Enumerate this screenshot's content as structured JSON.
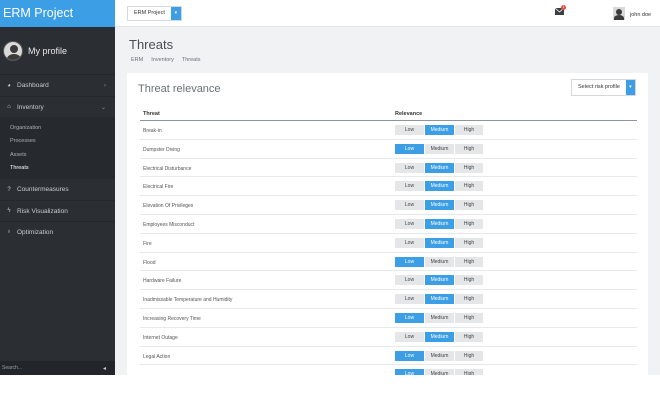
{
  "app": {
    "brand": "ERM Project"
  },
  "profile": {
    "label": "My profile"
  },
  "nav": {
    "dashboard": "Dashboard",
    "inventory": "Inventory",
    "inventory_children": [
      "Organization",
      "Processes",
      "Assets",
      "Threats"
    ],
    "countermeasures": "Countermeasures",
    "risk_visualization": "Risk Visualization",
    "optimization": "Optimization"
  },
  "sidebar_footer": {
    "search_placeholder": "Search..."
  },
  "topbar": {
    "project": "ERM Project",
    "mail_count": "1",
    "user": "john doe"
  },
  "page": {
    "title": "Threats",
    "breadcrumb": [
      "ERM",
      "Inventory",
      "Threats"
    ]
  },
  "panel": {
    "title": "Threat relevance",
    "risk_select_label": "Select risk profile",
    "columns": {
      "threat": "Threat",
      "relevance": "Relevance"
    },
    "levels": {
      "low": "Low",
      "medium": "Medium",
      "high": "High"
    },
    "rows": [
      {
        "name": "Break-in",
        "relevance": "Medium"
      },
      {
        "name": "Dumpster Diving",
        "relevance": "Low"
      },
      {
        "name": "Electrical Disturbance",
        "relevance": "Medium"
      },
      {
        "name": "Electrical Fire",
        "relevance": "Medium"
      },
      {
        "name": "Elevation Of Privileges",
        "relevance": "Medium"
      },
      {
        "name": "Employees Misconduct",
        "relevance": "Medium"
      },
      {
        "name": "Fire",
        "relevance": "Medium"
      },
      {
        "name": "Flood",
        "relevance": "Low"
      },
      {
        "name": "Hardware Failure",
        "relevance": "Medium"
      },
      {
        "name": "Inadmissable Temperature and Humidity",
        "relevance": "Medium"
      },
      {
        "name": "Increasing Recovery Time",
        "relevance": "Low"
      },
      {
        "name": "Internet Outage",
        "relevance": "Medium"
      },
      {
        "name": "Legal Action",
        "relevance": "Low"
      },
      {
        "name": "",
        "relevance": "Low"
      }
    ]
  },
  "colors": {
    "accent": "#3c9ee5",
    "sidebar": "#2b2e33",
    "content_bg": "#f1f2f4"
  }
}
